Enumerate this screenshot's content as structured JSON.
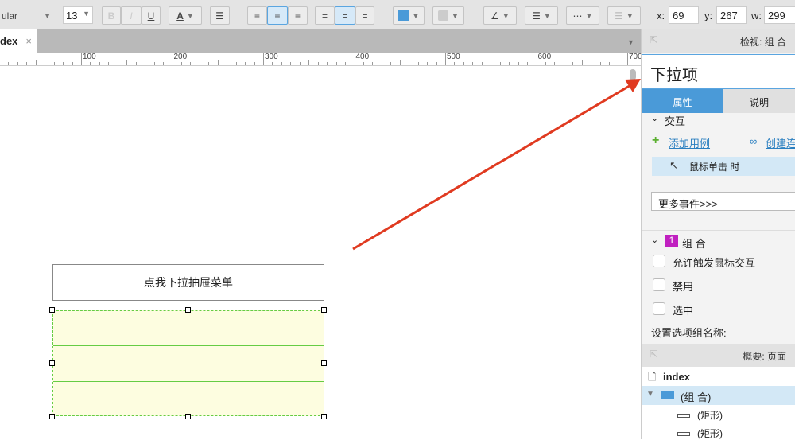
{
  "toolbar": {
    "font_style": "ular",
    "font_size": "13",
    "bold": "B",
    "italic": "I",
    "underline": "U",
    "font_color": "A",
    "x_label": "x:",
    "x_value": "69",
    "y_label": "y:",
    "y_value": "267",
    "w_label": "w:",
    "w_value": "299"
  },
  "tabs": {
    "active": "dex",
    "close": "×"
  },
  "ruler": {
    "labels": [
      "100",
      "200",
      "300",
      "400",
      "500",
      "600",
      "700"
    ]
  },
  "canvas": {
    "dropdown_button": "点我下拉抽屉菜单"
  },
  "inspector": {
    "header": "检视: 组 合",
    "name_value": "下拉项",
    "tab_properties": "属性",
    "tab_notes": "说明",
    "interactions_section": "交互",
    "add_case": "添加用例",
    "create_link": "创建连",
    "event": "鼠标单击 时",
    "more_events": "更多事件>>>",
    "group_badge": "1",
    "group_section": "组 合",
    "opt_allow_mouse": "允许触发鼠标交互",
    "opt_disabled": "禁用",
    "opt_selected": "选中",
    "option_group_label": "设置选项组名称:"
  },
  "outline": {
    "header": "概要: 页面",
    "page": "index",
    "group": "(组 合)",
    "items": [
      "(矩形)",
      "(矩形)"
    ]
  },
  "colors": {
    "accent": "#4a9ad8",
    "selection": "#d3e8f6",
    "group_fill": "#fdfde0",
    "group_border": "#66cc44",
    "arrow": "#e03a20",
    "badge": "#c020c0"
  }
}
